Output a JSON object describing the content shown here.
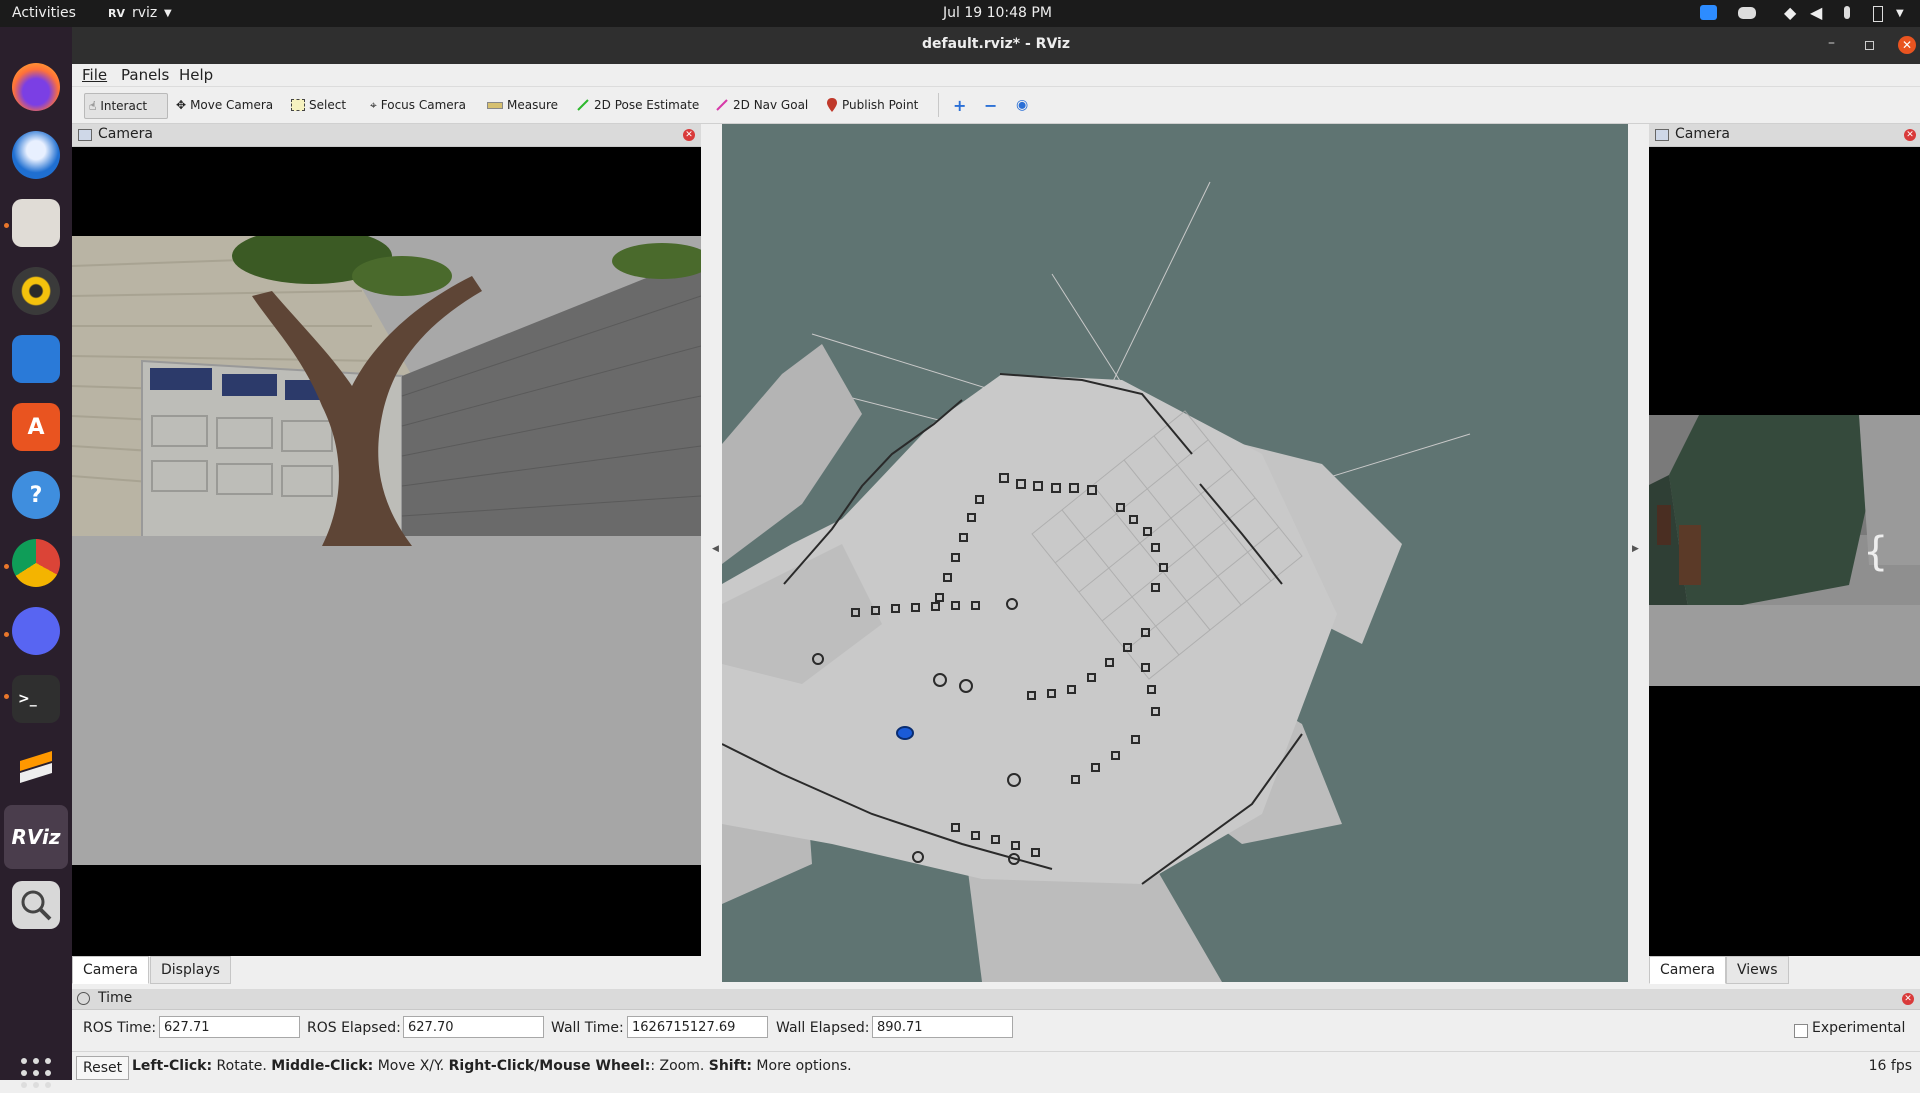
{
  "topbar": {
    "activities": "Activities",
    "app_menu": "rviz",
    "clock": "Jul 19  10:48 PM"
  },
  "window": {
    "title": "default.rviz* - RViz"
  },
  "menu": {
    "file": "File",
    "panels": "Panels",
    "help": "Help"
  },
  "toolbar": {
    "interact": "Interact",
    "move_camera": "Move Camera",
    "select": "Select",
    "focus_camera": "Focus Camera",
    "measure": "Measure",
    "pose_estimate": "2D Pose Estimate",
    "nav_goal": "2D Nav Goal",
    "publish_point": "Publish Point"
  },
  "left_panel": {
    "title": "Camera",
    "tabs": [
      "Camera",
      "Displays"
    ]
  },
  "right_panel": {
    "title": "Camera",
    "tabs": [
      "Camera",
      "Views"
    ]
  },
  "time_panel": {
    "title": "Time",
    "ros_time_label": "ROS Time:",
    "ros_time": "627.71",
    "ros_elapsed_label": "ROS Elapsed:",
    "ros_elapsed": "627.70",
    "wall_time_label": "Wall Time:",
    "wall_time": "1626715127.69",
    "wall_elapsed_label": "Wall Elapsed:",
    "wall_elapsed": "890.71",
    "experimental": "Experimental"
  },
  "statusbar": {
    "reset": "Reset",
    "hint_left_key": "Left-Click:",
    "hint_left": " Rotate. ",
    "hint_middle_key": "Middle-Click:",
    "hint_middle": " Move X/Y. ",
    "hint_right_key": "Right-Click/Mouse Wheel:",
    "hint_right": ": Zoom. ",
    "hint_shift_key": "Shift:",
    "hint_shift": " More options.",
    "fps": "16 fps"
  },
  "dock": {
    "rviz_label": "RViz",
    "terminal_label": ">_"
  },
  "colors": {
    "viewport_bg": "#5f7472",
    "map_free": "#c8c8c8",
    "dock_bg": "#2a1f2c"
  }
}
